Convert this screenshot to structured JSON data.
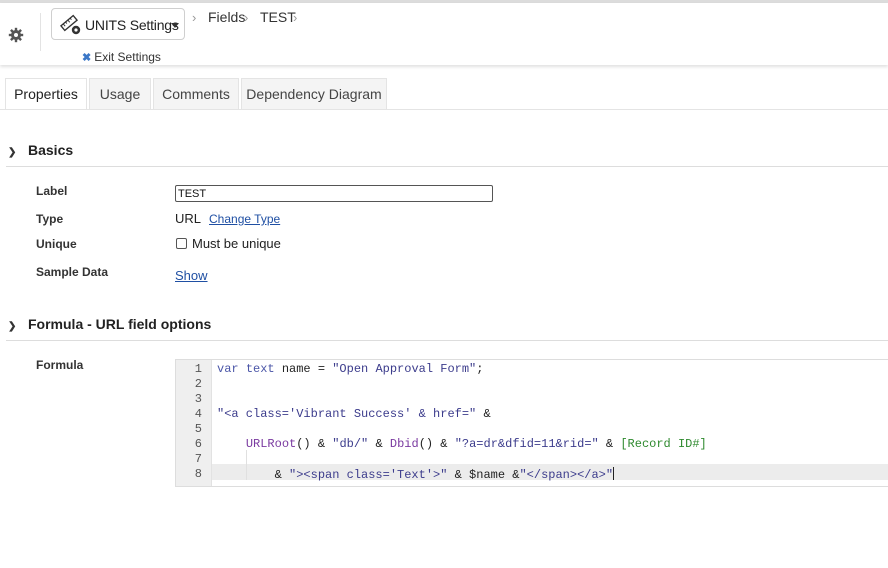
{
  "header": {
    "settings_label": "UNITS Settings",
    "breadcrumbs": [
      "Fields",
      "TEST"
    ],
    "exit_label": "Exit Settings",
    "icons": [
      "gear-icon",
      "ruler-gear-icon",
      "chevron-down-icon",
      "close-icon"
    ]
  },
  "tabs": [
    {
      "label": "Properties",
      "active": true
    },
    {
      "label": "Usage",
      "active": false
    },
    {
      "label": "Comments",
      "active": false
    },
    {
      "label": "Dependency Diagram",
      "active": false
    }
  ],
  "basics": {
    "title": "Basics",
    "label_field": {
      "label": "Label",
      "value": "TEST"
    },
    "type_field": {
      "label": "Type",
      "value": "URL",
      "link": "Change Type"
    },
    "unique_field": {
      "label": "Unique",
      "checkbox_label": "Must be unique",
      "checked": false
    },
    "sample_field": {
      "label": "Sample Data",
      "link": "Show"
    }
  },
  "formula_section": {
    "title": "Formula - URL field options",
    "field_label": "Formula",
    "line_numbers": [
      "1",
      "2",
      "3",
      "4",
      "5",
      "6",
      "7",
      "8"
    ],
    "lines": [
      "var text name = \"Open Approval Form\";",
      "",
      "",
      "\"<a class='Vibrant Success' & href=\" &",
      "",
      "    URLRoot() & \"db/\" & Dbid() & \"?a=dr&dfid=11&rid=\" & [Record ID#]",
      "",
      "        & \"><span class='Text'>\" & $name &\"</span></a>\""
    ]
  },
  "colors": {
    "link": "#1f4fa3",
    "keyword": "#4b56a8",
    "function": "#7a3aa0",
    "field": "#2f8a2f"
  }
}
